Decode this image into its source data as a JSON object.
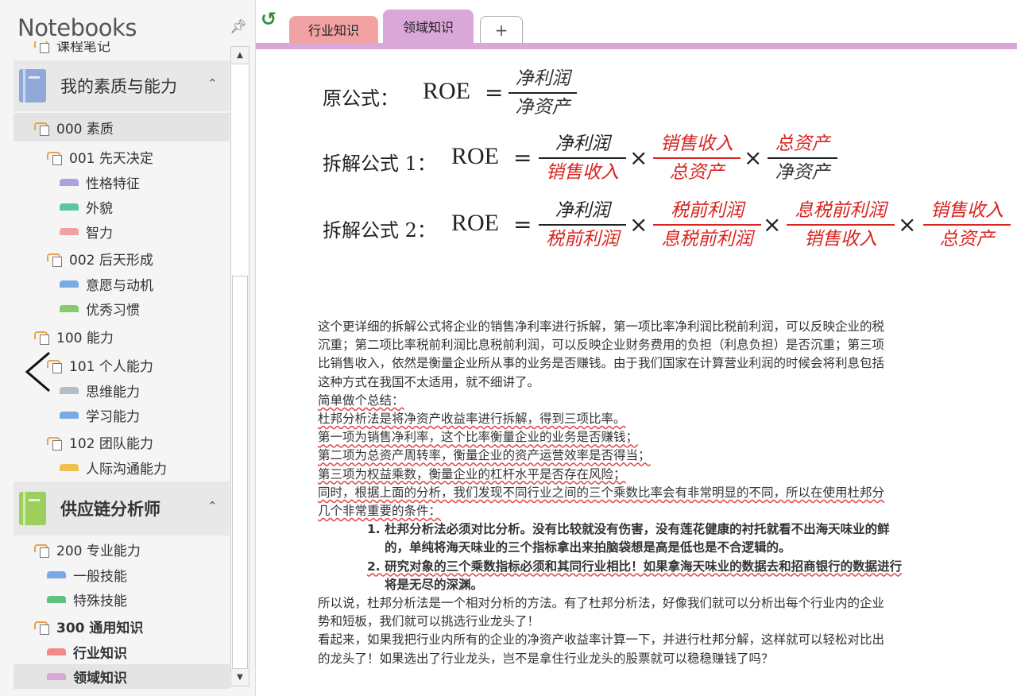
{
  "nav": {
    "title": "Notebooks",
    "pin_icon": "pin-icon",
    "items": [
      {
        "label": "课程笔记",
        "kind": "section-group",
        "level": 1,
        "partial": true
      },
      {
        "label": "我的素质与能力",
        "kind": "notebook",
        "color": "#8fa9d9"
      },
      {
        "label": "000 素质",
        "kind": "section-group",
        "level": 1
      },
      {
        "label": "001 先天决定",
        "kind": "section-group",
        "level": 2
      },
      {
        "label": "性格特征",
        "kind": "section",
        "color": "#a9a3e0"
      },
      {
        "label": "外貌",
        "kind": "section",
        "color": "#5cc4a7"
      },
      {
        "label": "智力",
        "kind": "section",
        "color": "#f0a1a1"
      },
      {
        "label": "002 后天形成",
        "kind": "section-group",
        "level": 2
      },
      {
        "label": "意愿与动机",
        "kind": "section",
        "color": "#7aa9e3"
      },
      {
        "label": "优秀习惯",
        "kind": "section",
        "color": "#86cc6a"
      },
      {
        "label": "100 能力",
        "kind": "section-group",
        "level": 1
      },
      {
        "label": "101 个人能力",
        "kind": "section-group",
        "level": 2
      },
      {
        "label": "思维能力",
        "kind": "section",
        "color": "#b5bcc4"
      },
      {
        "label": "学习能力",
        "kind": "section",
        "color": "#7aa9e3"
      },
      {
        "label": "102 团队能力",
        "kind": "section-group",
        "level": 2
      },
      {
        "label": "人际沟通能力",
        "kind": "section",
        "color": "#f0c04c"
      },
      {
        "label": "供应链分析师",
        "kind": "notebook",
        "color": "#9ccf5b"
      },
      {
        "label": "200 专业能力",
        "kind": "section-group",
        "level": 1
      },
      {
        "label": "一般技能",
        "kind": "section",
        "color": "#7aa9e3"
      },
      {
        "label": "特殊技能",
        "kind": "section",
        "color": "#5cc47f"
      },
      {
        "label": "300 通用知识",
        "kind": "section-group",
        "level": 1
      },
      {
        "label": "行业知识",
        "kind": "section",
        "color": "#f08a8a"
      },
      {
        "label": "领域知识",
        "kind": "section",
        "color": "#d9a7d8"
      }
    ]
  },
  "tabs": [
    {
      "label": "行业知识",
      "color": "#f1a3a3"
    },
    {
      "label": "领域知识",
      "color": "#d9a7d8",
      "active": true
    },
    {
      "label": "+"
    }
  ],
  "formulas": {
    "f0_label": "原公式：",
    "f1_label": "拆解公式 1：",
    "f2_label": "拆解公式 2：",
    "roe": "ROE",
    "eq": "=",
    "times": "×",
    "net_profit": "净利润",
    "net_assets": "净资产",
    "sales_revenue": "销售收入",
    "total_assets": "总资产",
    "pretax_profit": "税前利润",
    "ebit": "息税前利润"
  },
  "body": {
    "p1": "这个更详细的拆解公式将企业的销售净利率进行拆解，第一项比率净利润比税前利润，可以反映企业的税",
    "p2": "沉重；第二项比率税前利润比息税前利润，可以反映企业财务费用的负担（利息负担）是否沉重；第三项",
    "p3": "比销售收入，依然是衡量企业所从事的业务是否赚钱。由于我们国家在计算营业利润的时候会将利息包括",
    "p4": "这种方式在我国不太适用，就不细讲了。",
    "p5": "简单做个总结：",
    "p6": "杜邦分析法是将净资产收益率进行拆解，得到三项比率。",
    "p7": "第一项为销售净利率，这个比率衡量企业的业务是否赚钱；",
    "p8": "第二项为总资产周转率，衡量企业的资产运营效率是否得当；",
    "p9": "第三项为权益乘数，衡量企业的杠杆水平是否存在风险；",
    "p10": "同时，根据上面的分析，我们发现不同行业之间的三个乘数比率会有非常明显的不同，所以在使用杜邦分",
    "p11": "几个非常重要的条件：",
    "p12": "1.  杜邦分析法必须对比分析。没有比较就没有伤害，没有莲花健康的衬托就看不出海天味业的鲜",
    "p13": "的，单纯将海天味业的三个指标拿出来拍脑袋想是高是低也是不合逻辑的。",
    "p14": "2.  研究对象的三个乘数指标必须和其同行业相比！如果拿海天味业的数据去和招商银行的数据进行",
    "p15": "将是无尽的深渊。",
    "p16": "所以说，杜邦分析法是一个相对分析的方法。有了杜邦分析法，好像我们就可以分析出每个行业内的企业",
    "p17": "势和短板，我们就可以挑选行业龙头了！",
    "p18": "看起来，如果我把行业内所有的企业的净资产收益率计算一下，并进行杜邦分解，这样就可以轻松对比出",
    "p19": "的龙头了！如果选出了行业龙头，岂不是拿住行业龙头的股票就可以稳稳赚钱了吗？"
  }
}
